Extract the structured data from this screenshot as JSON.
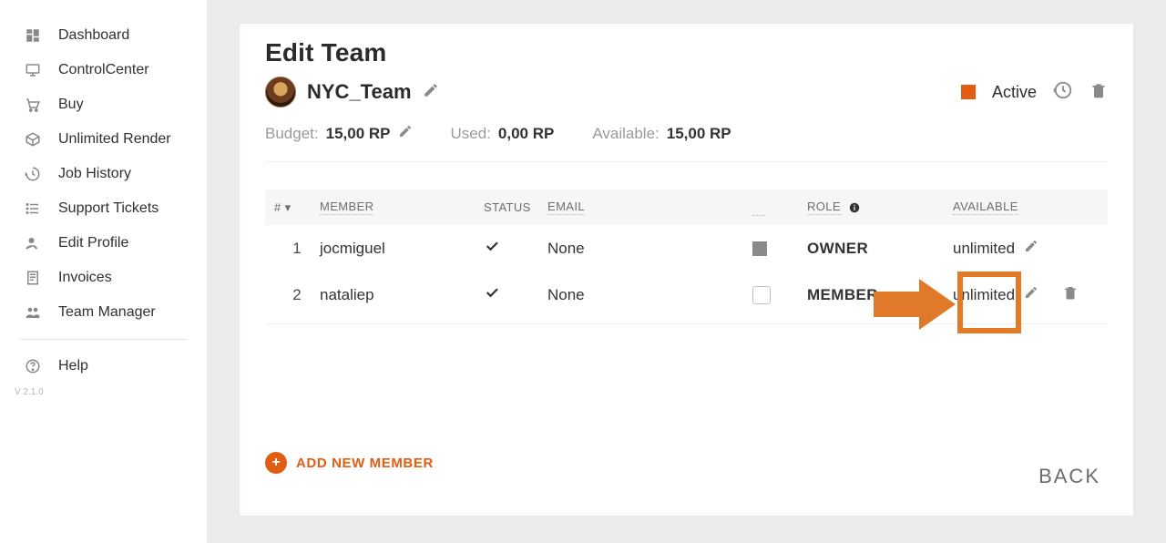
{
  "sidebar": {
    "items": [
      {
        "label": "Dashboard",
        "icon": "dashboard-icon"
      },
      {
        "label": "ControlCenter",
        "icon": "monitor-icon"
      },
      {
        "label": "Buy",
        "icon": "cart-icon"
      },
      {
        "label": "Unlimited Render",
        "icon": "box-icon"
      },
      {
        "label": "Job History",
        "icon": "history-icon"
      },
      {
        "label": "Support Tickets",
        "icon": "list-icon"
      },
      {
        "label": "Edit Profile",
        "icon": "user-edit-icon"
      },
      {
        "label": "Invoices",
        "icon": "invoice-icon"
      },
      {
        "label": "Team Manager",
        "icon": "team-icon"
      }
    ],
    "help_label": "Help",
    "version": "V 2.1.0"
  },
  "page": {
    "title": "Edit Team",
    "team_name": "NYC_Team",
    "status_label": "Active",
    "budget_label": "Budget:",
    "budget_value": "15,00 RP",
    "used_label": "Used:",
    "used_value": "0,00 RP",
    "available_label": "Available:",
    "available_value": "15,00 RP",
    "add_member_label": "ADD NEW MEMBER",
    "back_label": "BACK"
  },
  "table": {
    "headers": {
      "num": "#",
      "member": "MEMBER",
      "status": "STATUS",
      "email": "EMAIL",
      "role": "ROLE",
      "available": "AVAILABLE"
    },
    "rows": [
      {
        "num": "1",
        "member": "jocmiguel",
        "email": "None",
        "role": "OWNER",
        "available": "unlimited",
        "checked": true,
        "editable_role": false,
        "deletable": false
      },
      {
        "num": "2",
        "member": "nataliep",
        "email": "None",
        "role": "MEMBER",
        "available": "unlimited",
        "checked": false,
        "editable_role": true,
        "deletable": true
      }
    ]
  }
}
